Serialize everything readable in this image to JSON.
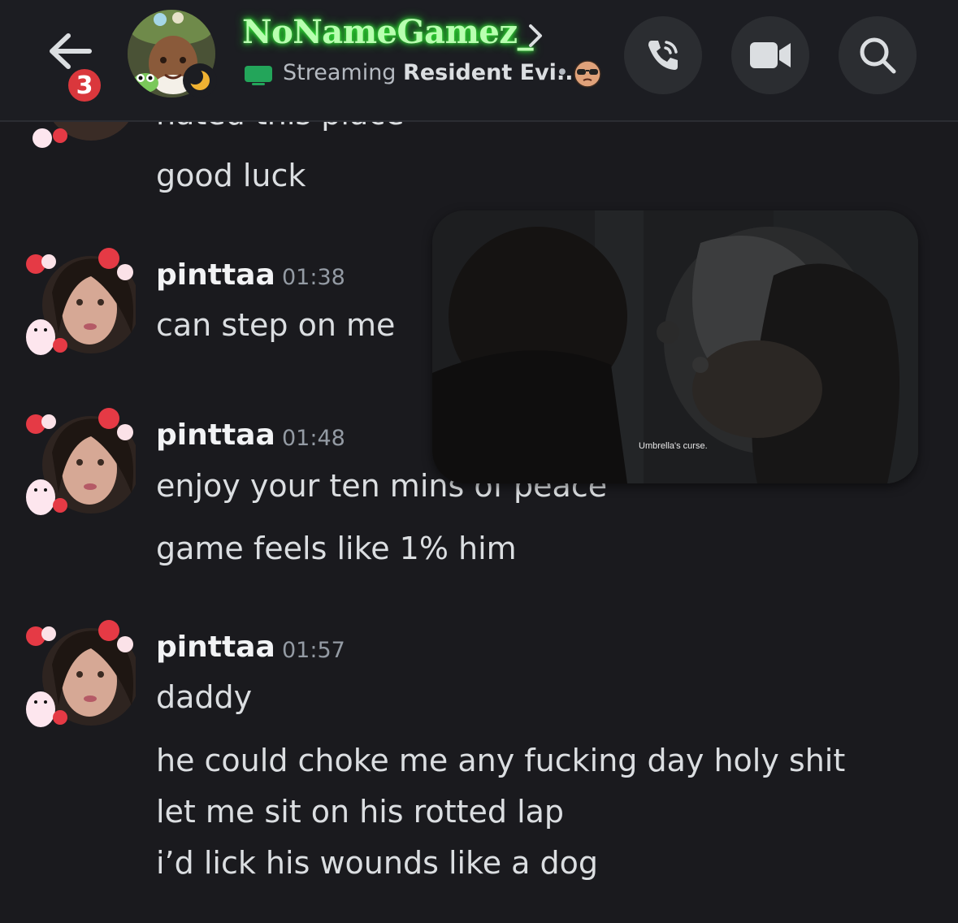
{
  "header": {
    "unread_count": "3",
    "user_name": "NoNameGamez_",
    "activity_prefix": "Streaming",
    "activity_game": "Resident Evi...",
    "activity_dot": "•"
  },
  "messages": {
    "partial_text": "hated this place",
    "good_luck": "good luck",
    "group1": {
      "author": "pinttaa",
      "time": "01:38",
      "line1": "can step on me"
    },
    "group2": {
      "author": "pinttaa",
      "time": "01:48",
      "line1": "enjoy your ten mins of peace",
      "line2": "game feels like 1% him"
    },
    "group3": {
      "author": "pinttaa",
      "time": "01:57",
      "line1": "daddy",
      "line2": "he could choke me any fucking day holy shit",
      "line3": "let me sit on his rotted lap",
      "line4": "i’d lick his wounds like a dog"
    }
  },
  "stream_preview": {
    "subtitle": "Umbrella's curse."
  },
  "colors": {
    "background": "#1a1a1e",
    "name_glow": "#39ff3a",
    "badge": "#da373c",
    "timestamp": "#949ba4"
  }
}
